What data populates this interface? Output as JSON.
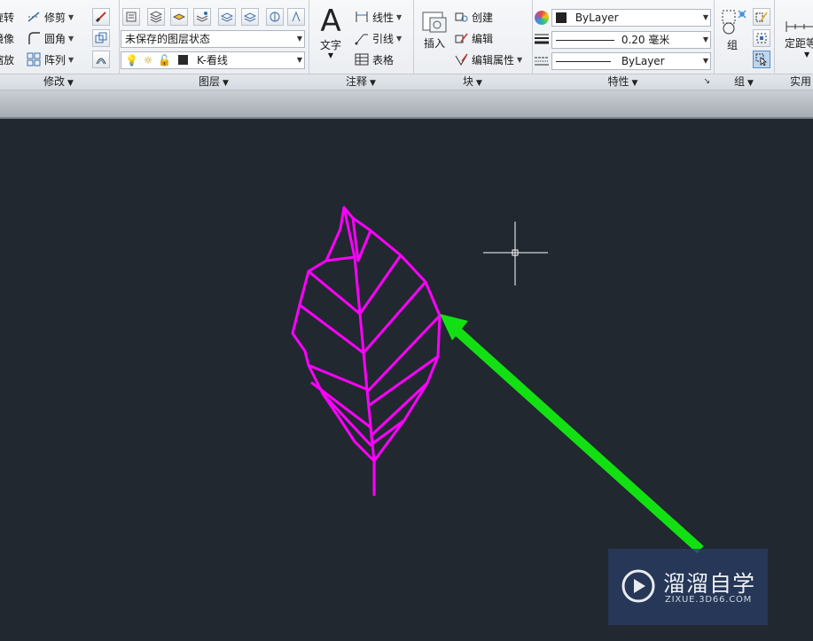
{
  "ribbon": {
    "modify": {
      "title": "修改",
      "rotate": "旋转",
      "mirror": "镜像",
      "scale": "缩放",
      "trim": "修剪",
      "fillet": "圆角",
      "array": "阵列"
    },
    "layers": {
      "title": "图层",
      "state_combo": "未保存的图层状态",
      "current_layer": "K-看线"
    },
    "annotation": {
      "title": "注释",
      "text": "文字",
      "linear": "线性",
      "leader": "引线",
      "table": "表格"
    },
    "block": {
      "title": "块",
      "insert": "插入",
      "create": "创建",
      "edit": "编辑",
      "edit_attributes": "编辑属性"
    },
    "properties": {
      "title": "特性",
      "color": "ByLayer",
      "lineweight": "0.20 毫米",
      "linetype": "ByLayer"
    },
    "groups": {
      "title": "组",
      "group": "组"
    },
    "utilities": {
      "title": "实用",
      "measure": "定距等"
    }
  },
  "watermark": {
    "brand": "溜溜自学",
    "url": "ZIXUE.3D66.COM"
  },
  "colors": {
    "canvas": "#212830",
    "leaf": "#ff00ff",
    "arrow": "#13e013",
    "crosshair": "#ffffff"
  }
}
